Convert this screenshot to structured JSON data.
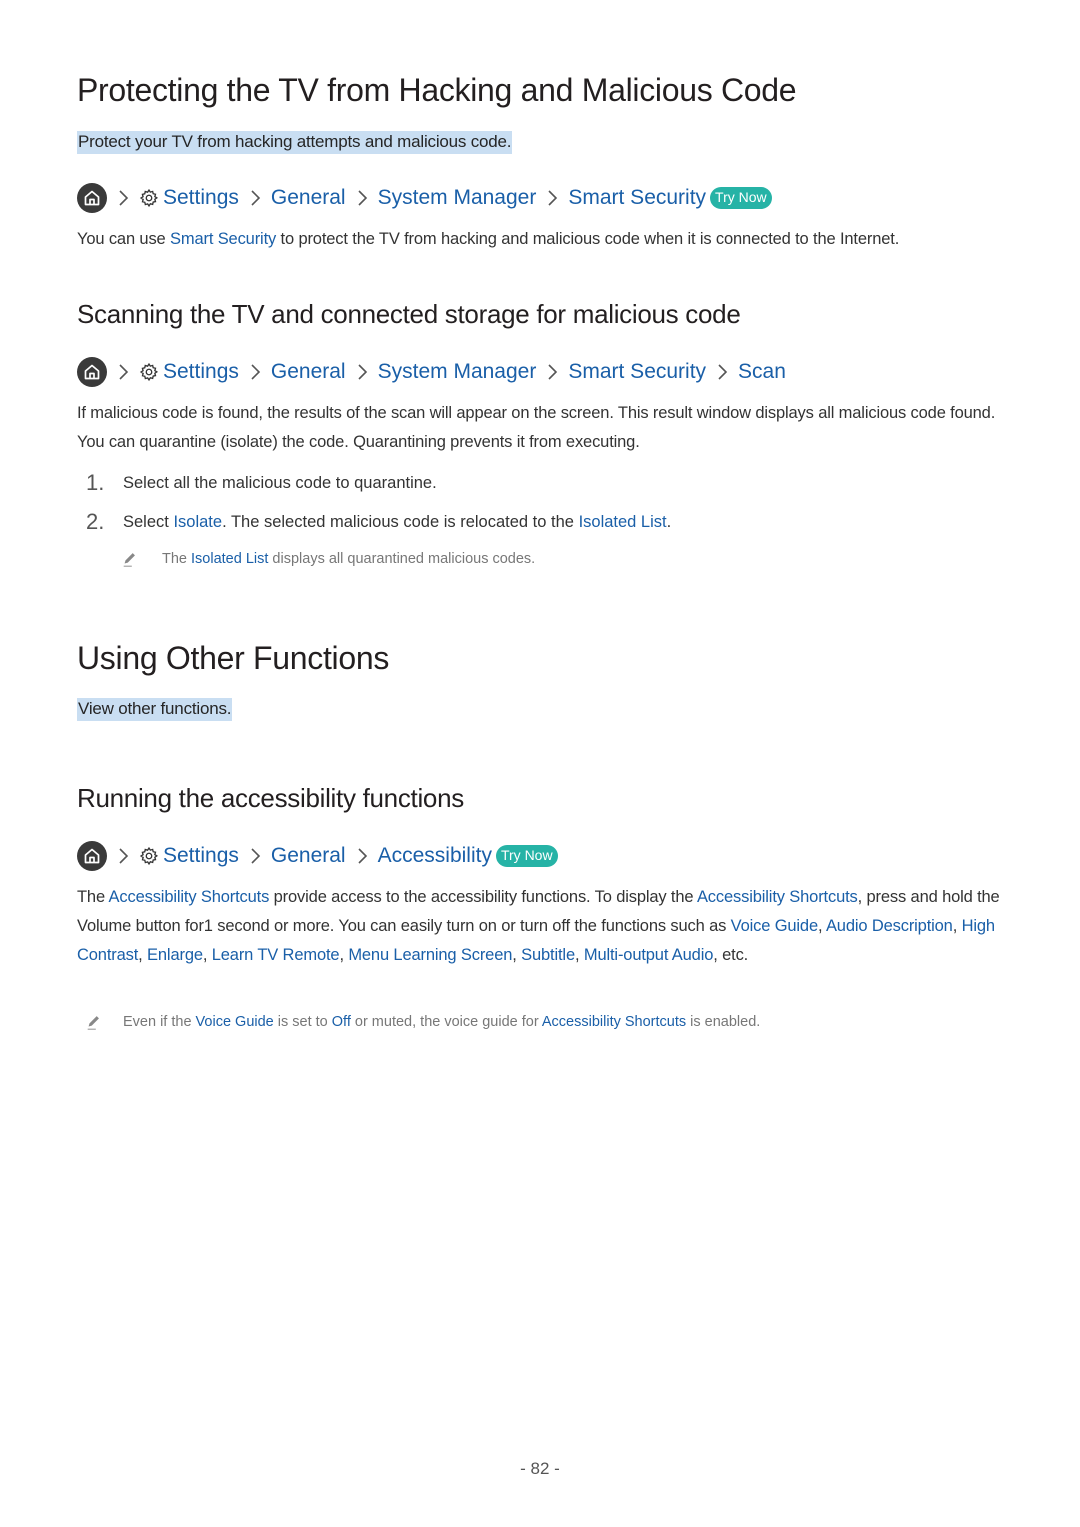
{
  "section1": {
    "title": "Protecting the TV from Hacking and Malicious Code",
    "intro": "Protect your TV from hacking attempts and malicious code.",
    "nav": {
      "home_icon": "home-icon",
      "settings_icon": "gear-icon",
      "items": [
        "Settings",
        "General",
        "System Manager",
        "Smart Security"
      ],
      "try_now": "Try Now"
    },
    "body": {
      "pre": "You can use ",
      "link": "Smart Security",
      "post": " to protect the TV from hacking and malicious code when it is connected to the Internet."
    }
  },
  "subsection1": {
    "title": "Scanning the TV and connected storage for malicious code",
    "nav": {
      "items": [
        "Settings",
        "General",
        "System Manager",
        "Smart Security",
        "Scan"
      ]
    },
    "body": "If malicious code is found, the results of the scan will appear on the screen. This result window displays all malicious code found. You can quarantine (isolate) the code. Quarantining prevents it from executing.",
    "steps": [
      {
        "num": "1.",
        "text": "Select all the malicious code to quarantine."
      },
      {
        "num": "2.",
        "pre": "Select ",
        "link1": "Isolate",
        "mid": ". The selected malicious code is relocated to the ",
        "link2": "Isolated List",
        "post": "."
      }
    ],
    "note": {
      "pre": "The ",
      "link": "Isolated List",
      "post": " displays all quarantined malicious codes."
    }
  },
  "section2": {
    "title": "Using Other Functions",
    "intro": "View other functions."
  },
  "subsection2": {
    "title": "Running the accessibility functions",
    "nav": {
      "items": [
        "Settings",
        "General",
        "Accessibility"
      ],
      "try_now": "Try Now"
    },
    "body": {
      "t1": "The ",
      "l1": "Accessibility Shortcuts",
      "t2": " provide access to the accessibility functions. To display the ",
      "l2": "Accessibility Shortcuts",
      "t3": ", press and hold the Volume button for1 second or more. You can easily turn on or turn off the functions such as ",
      "l3": "Voice Guide",
      "t4": ", ",
      "l4": "Audio Description",
      "t5": ", ",
      "l5": "High Contrast",
      "t6": ", ",
      "l6": "Enlarge",
      "t7": ", ",
      "l7": "Learn TV Remote",
      "t8": ", ",
      "l8": "Menu Learning Screen",
      "t9": ", ",
      "l9": "Subtitle",
      "t10": ", ",
      "l10": "Multi-output Audio",
      "t11": ", etc."
    },
    "note": {
      "t1": "Even if the ",
      "l1": "Voice Guide",
      "t2": " is set to ",
      "l2": "Off",
      "t3": " or muted, the voice guide for ",
      "l3": "Accessibility Shortcuts",
      "t4": " is enabled."
    }
  },
  "footer": {
    "page_number": "- 82 -"
  },
  "colors": {
    "link": "#1a5fa8",
    "try_now_bg": "#26b3a6",
    "intro_highlight": "#c9def2"
  }
}
